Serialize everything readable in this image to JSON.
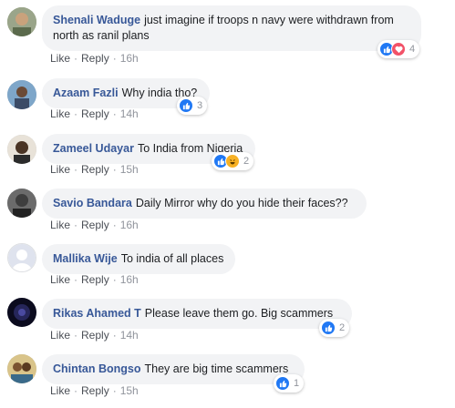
{
  "actions": {
    "like": "Like",
    "reply": "Reply",
    "sep": "·"
  },
  "colors": {
    "name": "#385898",
    "bubble": "#f2f3f5",
    "like": "#2078f4",
    "love": "#f25268",
    "haha": "#f7b125"
  },
  "comments": [
    {
      "author": "Shenali Waduge",
      "text": "just imagine if troops n navy were withdrawn from north as ranil plans",
      "time": "16h",
      "reactions": [
        "like-icon",
        "love-icon"
      ],
      "count": "4"
    },
    {
      "author": "Azaam Fazli",
      "text": "Why india tho?",
      "time": "14h",
      "reactions": [
        "like-icon"
      ],
      "count": "3"
    },
    {
      "author": "Zameel Udayar",
      "text": "To India from Nigeria",
      "time": "15h",
      "reactions": [
        "like-icon",
        "haha-icon"
      ],
      "count": "2"
    },
    {
      "author": "Savio Bandara",
      "text": "Daily Mirror why do you hide their faces??",
      "time": "16h",
      "reactions": [],
      "count": ""
    },
    {
      "author": "Mallika Wije",
      "text": "To india of all places",
      "time": "16h",
      "reactions": [],
      "count": ""
    },
    {
      "author": "Rikas Ahamed T",
      "text": "Please leave them go. Big scammers",
      "time": "14h",
      "reactions": [
        "like-icon"
      ],
      "count": "2"
    },
    {
      "author": "Chintan Bongso",
      "text": "They are big time scammers",
      "time": "15h",
      "reactions": [
        "like-icon"
      ],
      "count": "1"
    }
  ]
}
